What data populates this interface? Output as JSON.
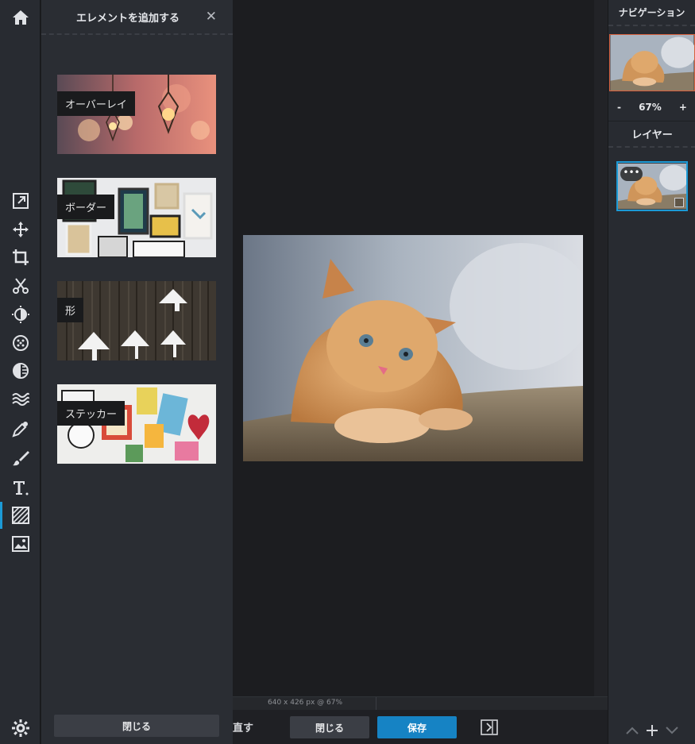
{
  "panel": {
    "title": "エレメントを追加する",
    "close_icon": "close-icon",
    "cards": [
      {
        "label": "オーバーレイ"
      },
      {
        "label": "ボーダー"
      },
      {
        "label": "形"
      },
      {
        "label": "ステッカー"
      }
    ],
    "close_button": "閉じる"
  },
  "toolbar": {
    "tools": [
      "home-icon",
      "resize-icon",
      "move-icon",
      "crop-icon",
      "cut-icon",
      "adjust-icon",
      "filter-icon",
      "effect-icon",
      "wave-icon",
      "picker-icon",
      "brush-icon",
      "text-icon",
      "element-icon",
      "image-icon",
      "settings-icon"
    ],
    "active": "element-icon",
    "accent": "#1c9ad6"
  },
  "canvas": {
    "status": "640 x 426 px @ 67%"
  },
  "bottom": {
    "undo_label": "直す",
    "close_label": "閉じる",
    "save_label": "保存",
    "save_color": "#1683c4"
  },
  "right": {
    "navigation_title": "ナビゲーション",
    "zoom_minus": "-",
    "zoom_level": "67%",
    "zoom_plus": "+",
    "layers_title": "レイヤー",
    "layer_more": "•••"
  }
}
